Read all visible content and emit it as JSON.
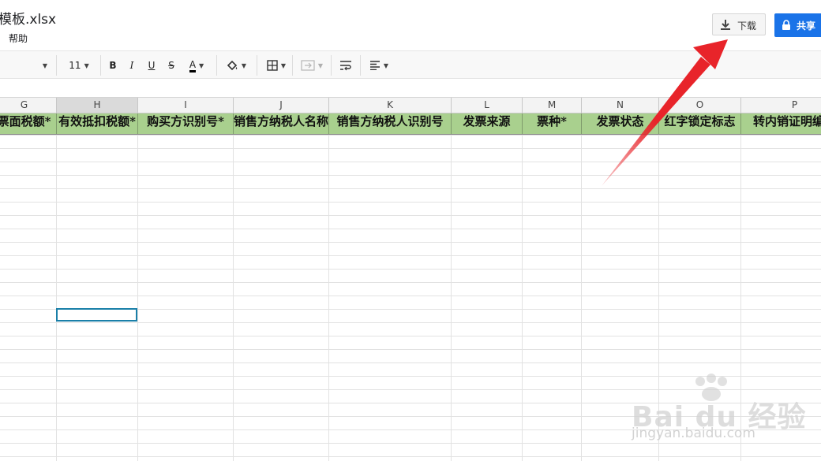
{
  "app": {
    "file_title": "模板.xlsx",
    "menu_help": "帮助",
    "download_label": "下载",
    "share_label": "共享"
  },
  "toolbar": {
    "font_size": "11",
    "bold": "B",
    "italic": "I",
    "underline": "U",
    "strike": "S",
    "text_color": "A"
  },
  "columns": [
    {
      "letter": "G",
      "header": "票面税额*"
    },
    {
      "letter": "H",
      "header": "有效抵扣税额*"
    },
    {
      "letter": "I",
      "header": "购买方识别号*"
    },
    {
      "letter": "J",
      "header": "销售方纳税人名称"
    },
    {
      "letter": "K",
      "header": "销售方纳税人识别号"
    },
    {
      "letter": "L",
      "header": "发票来源"
    },
    {
      "letter": "M",
      "header": "票种*"
    },
    {
      "letter": "N",
      "header": "发票状态"
    },
    {
      "letter": "O",
      "header": "红字锁定标志"
    },
    {
      "letter": "P",
      "header": "转内销证明编号"
    }
  ],
  "colors": {
    "header_fill": "#a9d08e",
    "share_button": "#1a73e8",
    "arrow": "#e8242a",
    "selection": "#1a7fa8"
  },
  "watermark": {
    "brand": "Bai du 经验",
    "url": "jingyan.baidu.com"
  }
}
